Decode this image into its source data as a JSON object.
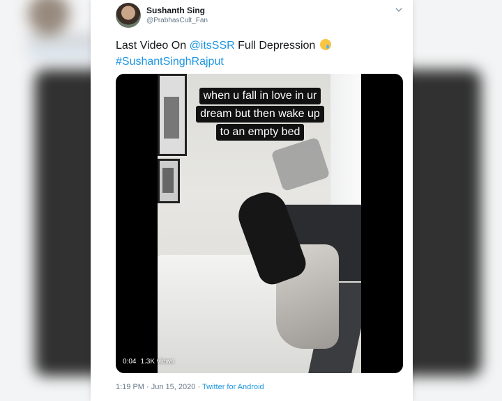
{
  "tweet": {
    "name": "Sushanth Sing",
    "handle": "@PrabhasCult_Fan",
    "text_prefix": "Last Video On ",
    "mention": "@itsSSR",
    "text_suffix": " Full Depression",
    "hashtag": "#SushantSinghRajput",
    "emoji_icon": "crying-face-emoji"
  },
  "video": {
    "caption_lines": [
      "when u fall in love in ur",
      "dream but then wake up",
      "to an empty bed"
    ],
    "time": "0:04",
    "views": "1.3K views"
  },
  "meta": {
    "time": "1:19 PM",
    "separator": "·",
    "date": "Jun 15, 2020",
    "source": "Twitter for Android"
  },
  "colors": {
    "link": "#1b95e0",
    "text": "#14171a",
    "muted": "#657786"
  }
}
